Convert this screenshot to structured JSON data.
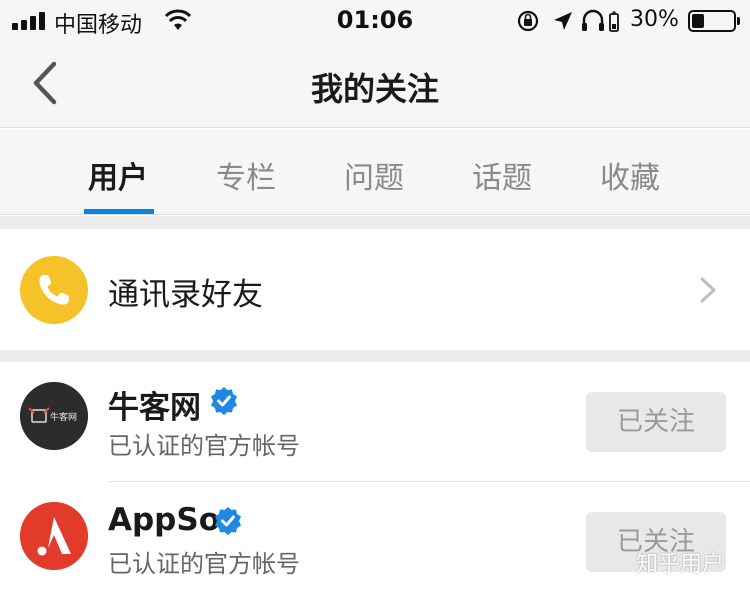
{
  "status_bar": {
    "carrier": "中国移动",
    "time": "01:06",
    "battery_percent": "30%",
    "battery_level": 0.3
  },
  "nav": {
    "title": "我的关注"
  },
  "tabs": [
    {
      "label": "用户",
      "active": true
    },
    {
      "label": "专栏",
      "active": false
    },
    {
      "label": "问题",
      "active": false
    },
    {
      "label": "话题",
      "active": false
    },
    {
      "label": "收藏",
      "active": false
    }
  ],
  "contacts_entry": {
    "label": "通讯录好友",
    "icon": "phone-icon"
  },
  "users": [
    {
      "name": "牛客网",
      "description": "已认证的官方帐号",
      "follow_label": "已关注",
      "verified": true,
      "avatar_text": "牛客网"
    },
    {
      "name": "AppSo",
      "description": "已认证的官方帐号",
      "follow_label": "已关注",
      "verified": true
    }
  ],
  "colors": {
    "accent": "#0a84e0",
    "phone_avatar": "#f6c22a",
    "appso_avatar": "#e23b2c",
    "verified_badge": "#1e88e5"
  },
  "watermark": "知乎用户"
}
